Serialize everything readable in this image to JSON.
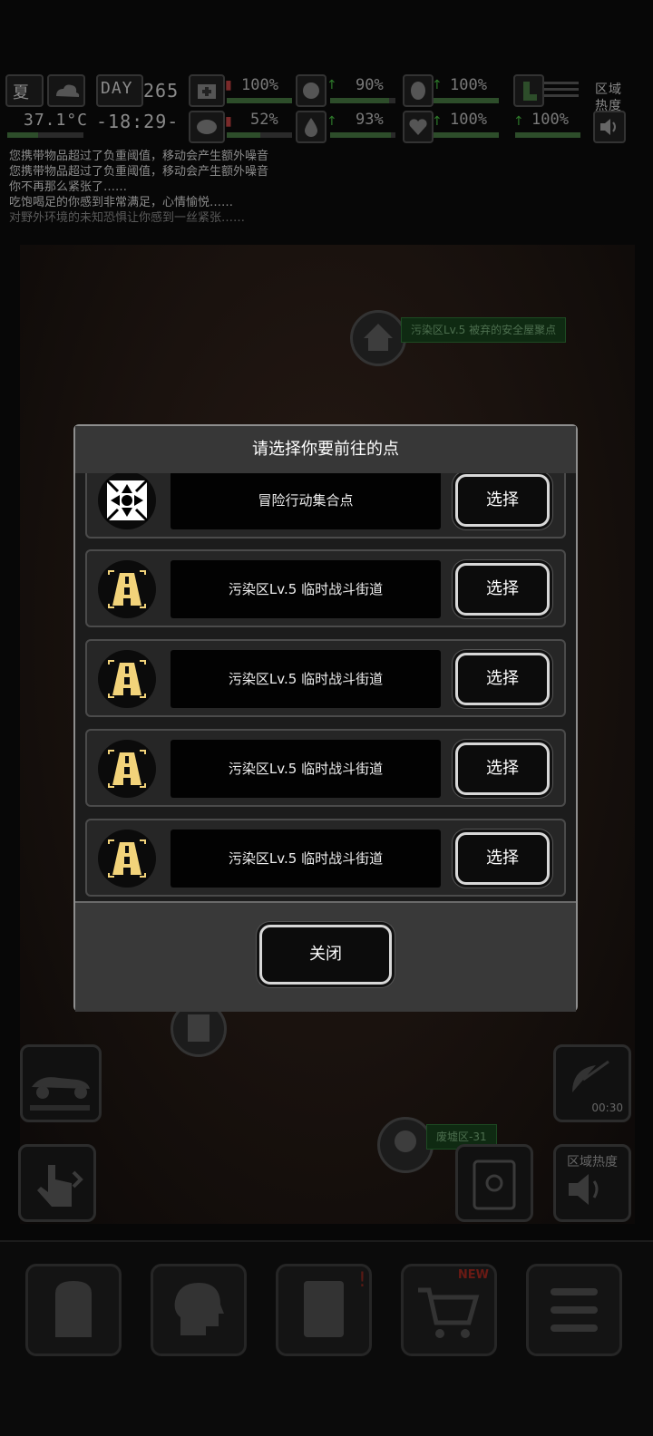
{
  "hud": {
    "season": "夏",
    "day_label": "DAY",
    "day": "265",
    "temperature": "37.1°C",
    "time": "-18:29-",
    "stats_top": [
      "100%",
      "90%",
      "100%"
    ],
    "stats_bottom": [
      "52%",
      "93%",
      "100%",
      "100%"
    ],
    "region_heat": "区域热度"
  },
  "log": {
    "lines": [
      "您携带物品超过了负重阈值，移动会产生额外噪音",
      "您携带物品超过了负重阈值，移动会产生额外噪音",
      "你不再那么紧张了……",
      "吃饱喝足的你感到非常满足，心情愉悦……",
      "对野外环境的未知恐惧让你感到一丝紧张……"
    ]
  },
  "map": {
    "pins": [
      "污染区Lv.5 被弃的安全屋聚点",
      "废墟区-31"
    ]
  },
  "side": {
    "timer": "00:30",
    "region_heat": "区域热度"
  },
  "bottom": {
    "new_badge": "NEW"
  },
  "modal": {
    "title": "请选择你要前往的点",
    "select_label": "选择",
    "close_label": "关闭",
    "items": [
      {
        "name": "冒险行动集合点",
        "icon": "rally-point-icon"
      },
      {
        "name": "污染区Lv.5 临时战斗街道",
        "icon": "road-icon"
      },
      {
        "name": "污染区Lv.5 临时战斗街道",
        "icon": "road-icon"
      },
      {
        "name": "污染区Lv.5 临时战斗街道",
        "icon": "road-icon"
      },
      {
        "name": "污染区Lv.5 临时战斗街道",
        "icon": "road-icon"
      }
    ]
  },
  "colors": {
    "modal_bg": "#3b3b3b",
    "row_bg": "#262626",
    "button_border": "#d8d8d8",
    "road_icon": "#f2d37a"
  }
}
